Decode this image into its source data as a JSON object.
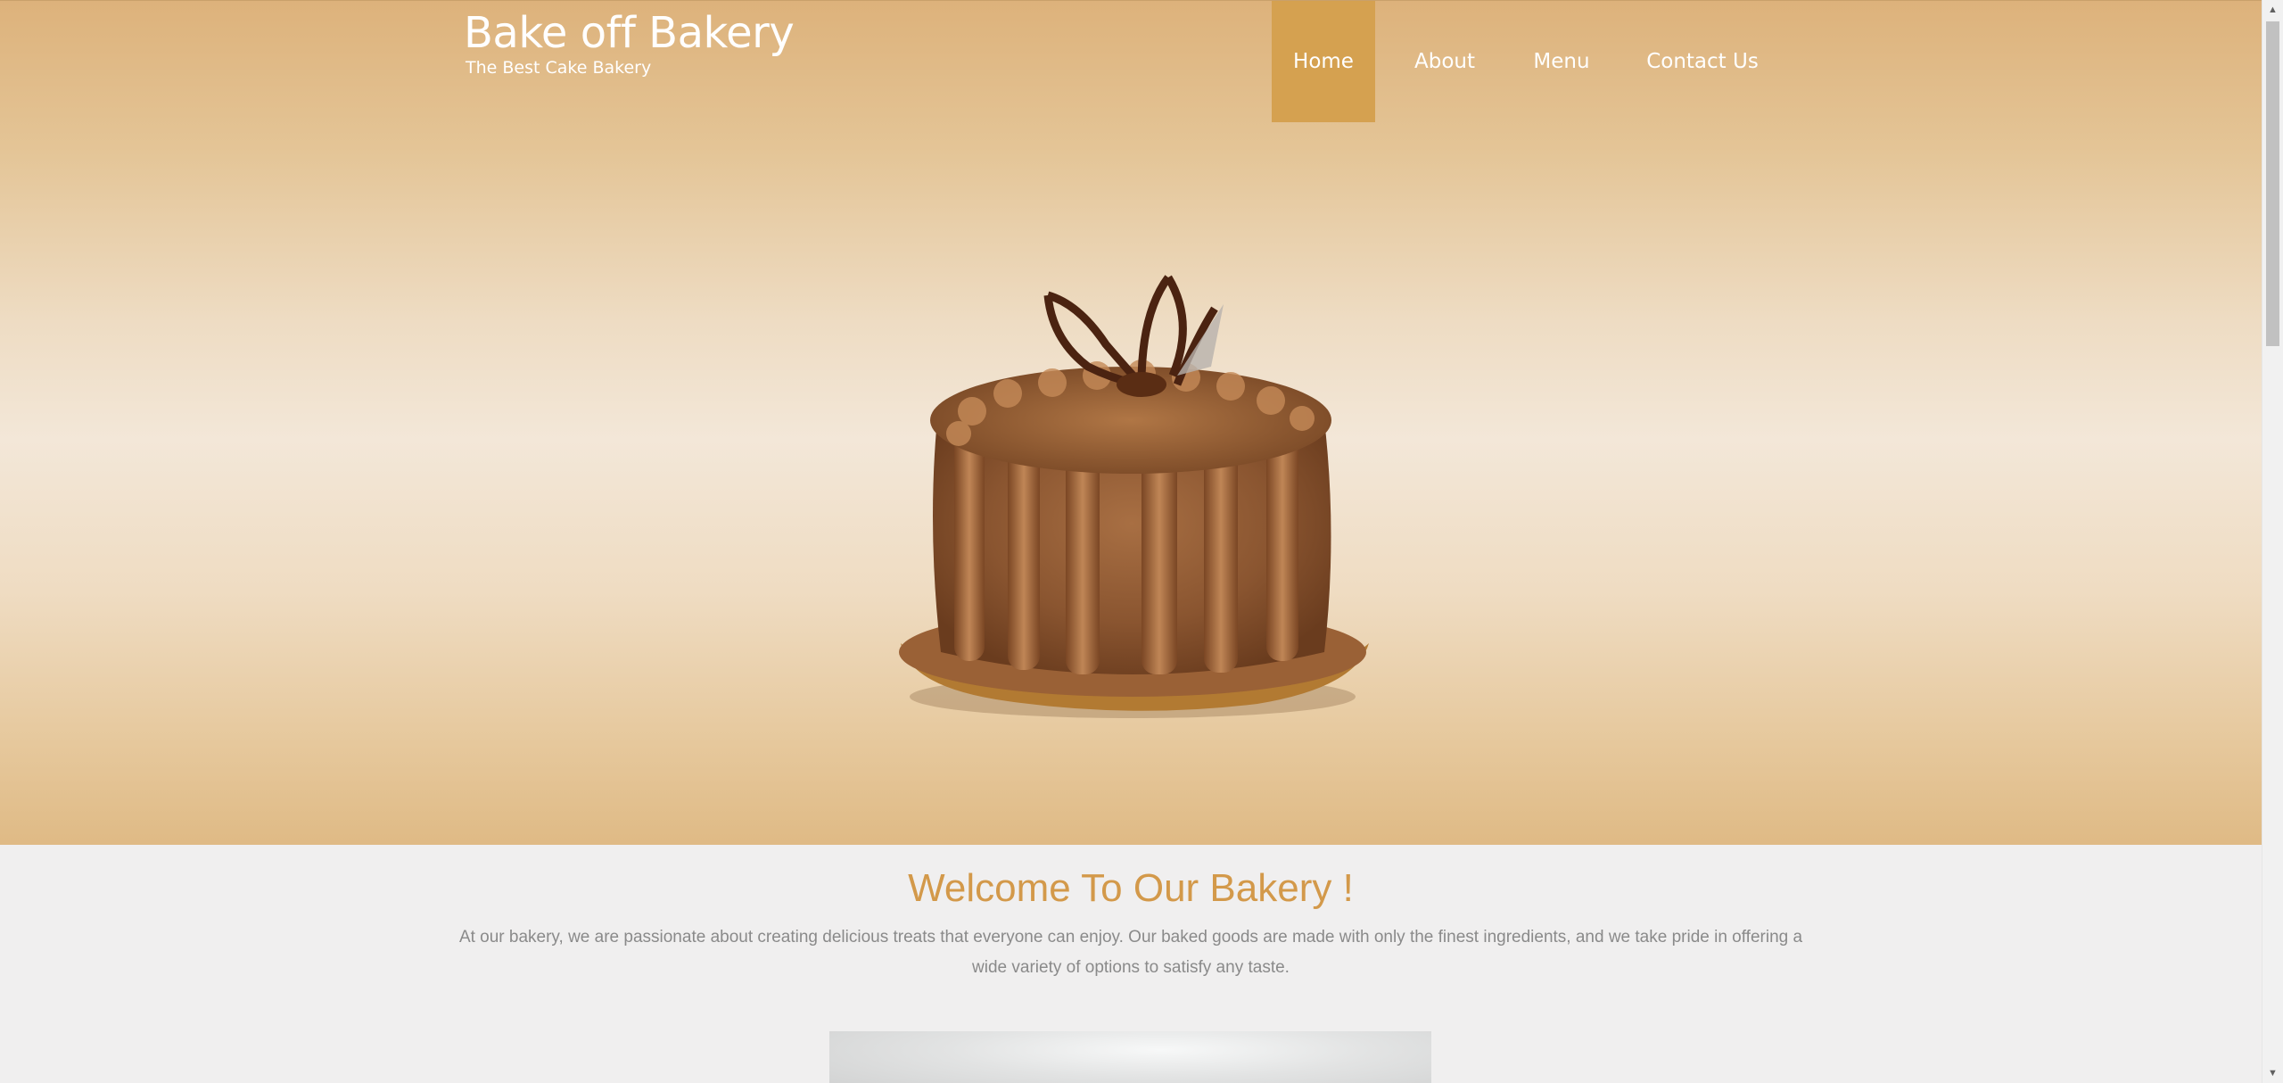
{
  "brand": {
    "title": "Bake off Bakery",
    "tagline": "The Best Cake Bakery"
  },
  "nav": {
    "items": [
      {
        "label": "Home",
        "active": true
      },
      {
        "label": "About",
        "active": false
      },
      {
        "label": "Menu",
        "active": false
      },
      {
        "label": "Contact Us",
        "active": false
      }
    ]
  },
  "hero": {
    "image": "chocolate-cake-image"
  },
  "welcome": {
    "title": "Welcome To Our Bakery !",
    "text": "At our bakery, we are passionate about creating delicious treats that everyone can enjoy. Our baked goods are made with only the finest ingredients, and we take pride in offering a wide variety of options to satisfy any taste."
  },
  "colors": {
    "accent": "#d5a150",
    "title": "#d3994a",
    "body_text": "#8a8a8a",
    "page_background": "#f0efef"
  },
  "scrollbar": {
    "up_icon": "triangle-up-icon",
    "down_icon": "triangle-down-icon"
  }
}
